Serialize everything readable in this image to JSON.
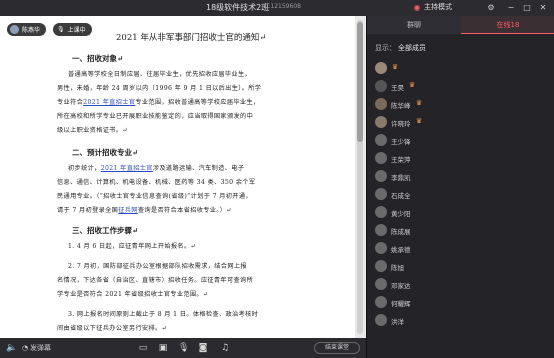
{
  "titlebar": {
    "title": "18级软件技术2班",
    "id_text": "ID:12159608",
    "mode": "主持模式"
  },
  "presenter": {
    "name": "陈燕华"
  },
  "stage_button": "上课中",
  "document": {
    "title": "2021 年从非军事部门招收士官的通知↵",
    "sections": [
      {
        "heading": "一、招收对象↵"
      },
      {
        "heading": "二、预计招收专业↵"
      },
      {
        "heading": "三、招收工作步骤↵"
      }
    ],
    "lines": [
      "普通高等学校全日制应届、往届毕业生，优先招收应届毕业生，",
      "男性，未婚，年龄 24 周岁以内（1996 年 9 月 1 日以后出生）。所学",
      "专业符合",
      "2021 年直招士官",
      "专业范围，招收普通高等学校应届毕业生，",
      "所在高校和所学专业已开展职业技能鉴定的，应当取得国家颁发的中",
      "级以上职业资格证书。↵",
      "初步统计，",
      "2021 年直招士官",
      "涉及道路运输、汽车制造、电子",
      "信息、通信、计算机、机电设备、机械、医药等 34 类、350 余个军",
      "民通用专业。（",
      "“招收士官专业信息查询(省级)”计划于 7 月初开通，",
      "请于 7 月初登录全国",
      "征兵网",
      "查询是否符合本省招收专业。）↵",
      "1. 4 月 6 日起，应征青年网上开始报名。↵",
      "2. 7 月初，国防部征兵办公室根据部队招收需求，结合网上报",
      "名情况，下达各省（自治区、直辖市）招收任务。应征青年可查询所",
      "学专业是否符合 2021 年省级招收士官专业范围。↵",
      "3. 网上报名时间原则上截止于 8 月 1 日。体格检查、政治考核时",
      "间由省级以下征兵办公室另行安排。↵"
    ]
  },
  "bottombar": {
    "danmu_label": "发弹幕",
    "end_button": "结束课堂"
  },
  "panel": {
    "tab_chat": "群聊",
    "tab_online": "在线18",
    "filter_label": "显示：",
    "filter_value": "全部成员",
    "users": [
      {
        "name": "",
        "badge": "host",
        "color": "#9a8a7a"
      },
      {
        "name": "王昊",
        "badge": "host",
        "color": "#555"
      },
      {
        "name": "陈华峰",
        "badge": "host",
        "color": "#7a6a5a"
      },
      {
        "name": "许晓玲",
        "badge": "host",
        "color": "#8a7a6a"
      },
      {
        "name": "王少锋",
        "badge": "",
        "color": "#6a6a6a"
      },
      {
        "name": "王荣萍",
        "badge": "",
        "color": "#6a6a6a"
      },
      {
        "name": "李鼎凯",
        "badge": "",
        "color": "#6a6a6a"
      },
      {
        "name": "石成全",
        "badge": "",
        "color": "#6a6a6a"
      },
      {
        "name": "黄少阳",
        "badge": "",
        "color": "#6a6a6a"
      },
      {
        "name": "陈成展",
        "badge": "",
        "color": "#6a6a6a"
      },
      {
        "name": "姚承德",
        "badge": "",
        "color": "#6a6a6a"
      },
      {
        "name": "陈旭",
        "badge": "",
        "color": "#6a6a6a"
      },
      {
        "name": "邓家达",
        "badge": "",
        "color": "#6a6a6a"
      },
      {
        "name": "何耀辉",
        "badge": "",
        "color": "#6a6a6a"
      },
      {
        "name": "洪洋",
        "badge": "",
        "color": "#6a6a6a"
      }
    ]
  },
  "colors": {
    "accent": "#ff5b64",
    "host_badge": "#ff9a3c",
    "link": "#2a4bc8"
  }
}
